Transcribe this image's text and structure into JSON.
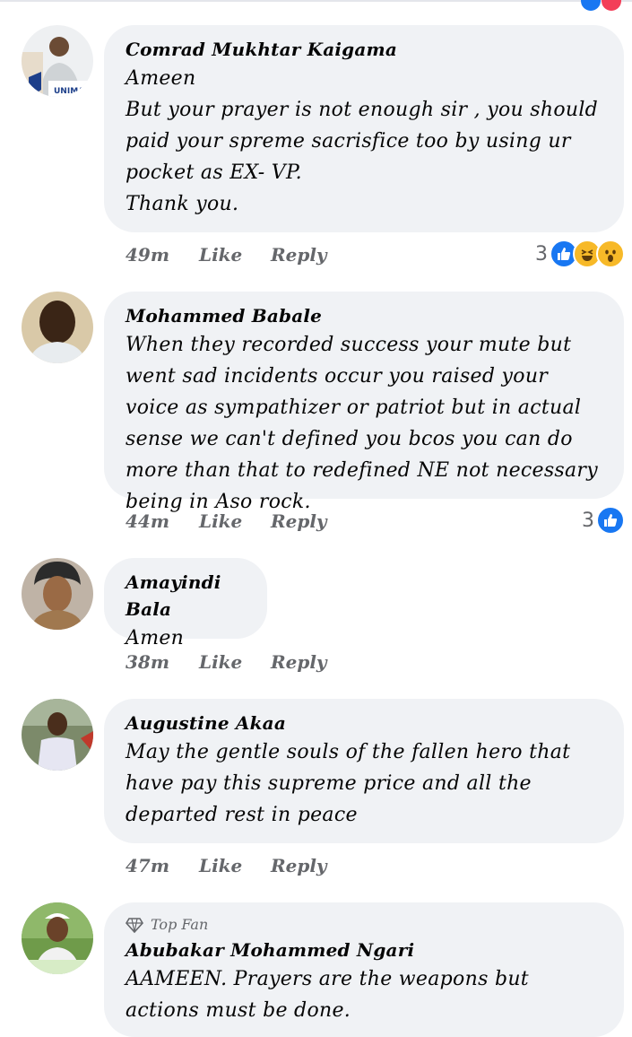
{
  "comments": [
    {
      "author": "Comrad Mukhtar Kaigama",
      "text": "Ameen\nBut your prayer is not enough sir , you should paid your spreme sacrisfice too by using ur pocket as EX- VP.\nThank you.",
      "time": "49m",
      "like_label": "Like",
      "reply_label": "Reply",
      "reaction_count": "3",
      "reactions": [
        "like-icon",
        "haha-icon",
        "wow-icon"
      ],
      "avatar_caption": "UNIMA"
    },
    {
      "author": "Mohammed Babale",
      "text": "When they recorded success your mute but went sad incidents occur you raised your voice as sympathizer or patriot but in actual sense we can't defined you bcos you can do more than that to redefined NE not necessary being in Aso rock.",
      "time": "44m",
      "like_label": "Like",
      "reply_label": "Reply",
      "reaction_count": "3",
      "reactions": [
        "like-icon"
      ]
    },
    {
      "author": "Amayindi Bala",
      "text": "Amen",
      "time": "38m",
      "like_label": "Like",
      "reply_label": "Reply"
    },
    {
      "author": "Augustine Akaa",
      "text": "May the gentle souls of the fallen hero that have pay this supreme price and all the departed rest in peace",
      "time": "47m",
      "like_label": "Like",
      "reply_label": "Reply"
    },
    {
      "badge": "Top Fan",
      "author": "Abubakar Mohammed Ngari",
      "text": "AAMEEN. Prayers are the weapons but actions must be done."
    }
  ],
  "colors": {
    "bubble": "#f0f2f5",
    "meta_text": "#65676b",
    "like_blue": "#1877f2",
    "emoji_yellow": "#f7b928"
  }
}
